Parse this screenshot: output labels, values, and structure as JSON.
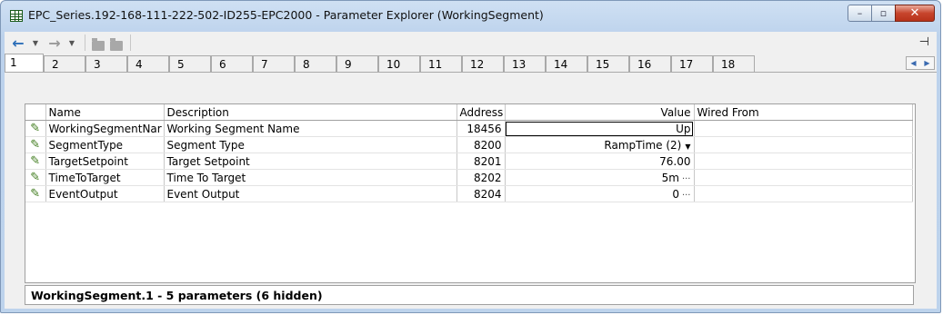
{
  "window": {
    "title": "EPC_Series.192-168-111-222-502-ID255-EPC2000 - Parameter Explorer (WorkingSegment)",
    "buttons": {
      "minimize": "–",
      "maximize": "▫",
      "close": "✕"
    }
  },
  "toolbar": {
    "back_icon": "←",
    "forward_icon": "→",
    "dropdown_icon": "▼",
    "pin_icon": "⊣"
  },
  "tabs": [
    "1",
    "2",
    "3",
    "4",
    "5",
    "6",
    "7",
    "8",
    "9",
    "10",
    "11",
    "12",
    "13",
    "14",
    "15",
    "16",
    "17",
    "18"
  ],
  "table": {
    "headers": {
      "name": "Name",
      "description": "Description",
      "address": "Address",
      "value": "Value",
      "wired_from": "Wired From"
    },
    "rows": [
      {
        "name": "WorkingSegmentNar",
        "description": "Working Segment Name",
        "address": "18456",
        "value": "Up",
        "wired_from": ""
      },
      {
        "name": "SegmentType",
        "description": "Segment Type",
        "address": "8200",
        "value": "RampTime (2)",
        "wired_from": ""
      },
      {
        "name": "TargetSetpoint",
        "description": "Target Setpoint",
        "address": "8201",
        "value": "76.00",
        "wired_from": ""
      },
      {
        "name": "TimeToTarget",
        "description": "Time To Target",
        "address": "8202",
        "value": "5m",
        "wired_from": ""
      },
      {
        "name": "EventOutput",
        "description": "Event Output",
        "address": "8204",
        "value": "0",
        "wired_from": ""
      }
    ]
  },
  "status": "WorkingSegment.1  -  5 parameters (6 hidden)"
}
